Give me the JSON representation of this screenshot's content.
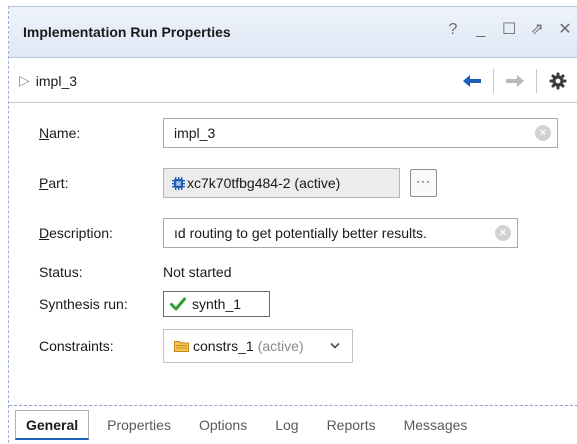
{
  "window": {
    "title": "Implementation Run Properties",
    "controls": {
      "help": "?",
      "minimize": "_",
      "maximize": "☐",
      "float": "⇗",
      "close": "✕"
    }
  },
  "toolbar": {
    "run_name": "impl_3"
  },
  "form": {
    "name": {
      "label_prefix": "N",
      "label_rest": "ame:",
      "value": "impl_3"
    },
    "part": {
      "label_prefix": "P",
      "label_rest": "art:",
      "value": "xc7k70tfbg484-2 (active)",
      "more_label": "···"
    },
    "description": {
      "label_prefix": "D",
      "label_rest": "escription:",
      "value": "ıd routing to get potentially better results."
    },
    "status": {
      "label": "Status:",
      "value": "Not started"
    },
    "synthesis_run": {
      "label": "Synthesis run:",
      "value": "synth_1"
    },
    "constraints": {
      "label": "Constraints:",
      "value": "constrs_1",
      "suffix": "(active)"
    }
  },
  "tabs": [
    {
      "label": "General"
    },
    {
      "label": "Properties"
    },
    {
      "label": "Options"
    },
    {
      "label": "Log"
    },
    {
      "label": "Reports"
    },
    {
      "label": "Messages"
    }
  ],
  "colors": {
    "accent": "#1f5fb7",
    "check": "#2e9e2e",
    "folder": "#e0a72e"
  },
  "icons": {
    "expand": "triangle-right-icon",
    "back": "arrow-left-icon",
    "forward": "arrow-right-icon",
    "settings": "gear-icon",
    "part": "chip-icon",
    "check": "check-icon",
    "folder": "folder-icon",
    "dropdown": "chevron-down-icon"
  }
}
